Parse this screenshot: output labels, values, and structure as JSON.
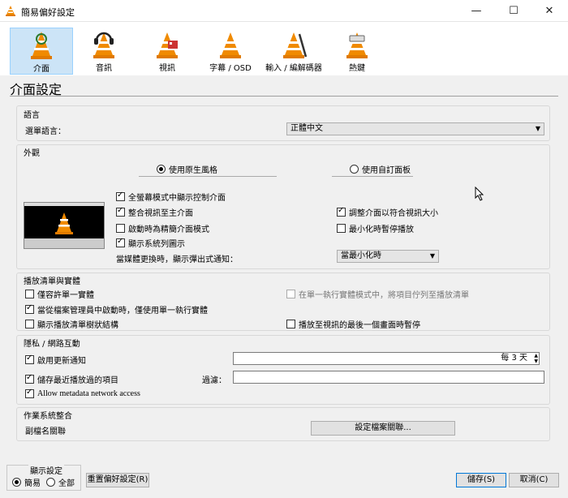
{
  "window": {
    "title": "簡易偏好設定",
    "min": "—",
    "max": "☐",
    "close": "✕"
  },
  "toolbar": {
    "tabs": [
      {
        "label": "介面",
        "icon": "interface-icon",
        "selected": true
      },
      {
        "label": "音訊",
        "icon": "audio-icon",
        "selected": false
      },
      {
        "label": "視訊",
        "icon": "video-icon",
        "selected": false
      },
      {
        "label": "字幕 / OSD",
        "icon": "subtitles-icon",
        "selected": false
      },
      {
        "label": "輸入 / 編解碼器",
        "icon": "codecs-icon",
        "selected": false
      },
      {
        "label": "熱鍵",
        "icon": "hotkeys-icon",
        "selected": false
      }
    ]
  },
  "heading": "介面設定",
  "language": {
    "section": "語言",
    "label": "選單語言：",
    "value": "正體中文"
  },
  "appearance": {
    "section": "外觀",
    "radio_native": "使用原生風格",
    "radio_custom": "使用自訂面板",
    "native_selected": true,
    "cb_fullscreen": "全螢幕模式中顯示控制介面",
    "cb_integrate": "整合視訊至主介面",
    "cb_minimal": "啟動時為精簡介面模式",
    "cb_systray": "顯示系統列圖示",
    "cb_resize": "調整介面以符合視訊大小",
    "cb_pause_min": "最小化時暫停播放",
    "notify_label": "當媒體更換時，顯示彈出式通知：",
    "notify_value": "當最小化時",
    "states": {
      "fullscreen": true,
      "integrate": true,
      "minimal": false,
      "systray": true,
      "resize": true,
      "pause_min": false
    }
  },
  "playlist": {
    "section": "播放清單與實體",
    "cb_one": "僅容許單一實體",
    "cb_enqueue": "在單一執行實體模式中，將項目佇列至播放清單",
    "cb_filemgr": "當從檔案管理員中啟動時，僅使用單一執行實體",
    "cb_tree": "顯示播放清單樹狀結構",
    "cb_pause_last": "播放至視訊的最後一個畫面時暫停",
    "states": {
      "one": false,
      "enqueue": false,
      "filemgr": true,
      "tree": false,
      "pause_last": false
    }
  },
  "privacy": {
    "section": "隱私 / 網路互動",
    "cb_update": "啟用更新通知",
    "update_value": "每 3 天",
    "cb_recent": "儲存最近播放過的項目",
    "filter_label": "過濾：",
    "filter_value": "",
    "cb_metadata": "Allow metadata network access",
    "states": {
      "update": true,
      "recent": true,
      "metadata": true
    }
  },
  "os": {
    "section": "作業系統整合",
    "label": "副檔名關聯",
    "button": "設定檔案關聯..."
  },
  "footer": {
    "show_label": "顯示設定",
    "simple": "簡易",
    "all": "全部",
    "reset": "重置偏好設定(R)",
    "save": "儲存(S)",
    "cancel": "取消(C)"
  }
}
